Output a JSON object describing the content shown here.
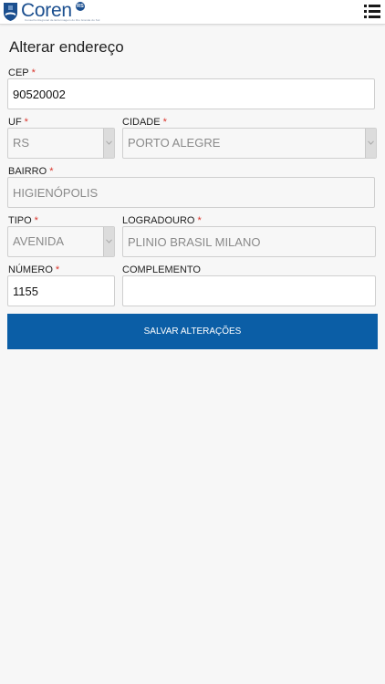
{
  "header": {
    "brand": "Coren",
    "badge": "RS",
    "tagline": "Conselho Regional de Enfermagem do Rio Grande do Sul",
    "logo_icon": "shield-icon",
    "menu_icon": "list-menu-icon",
    "brand_color": "#1b4f8f"
  },
  "page": {
    "title": "Alterar endereço"
  },
  "form": {
    "required_mark": "*",
    "cep": {
      "label": "CEP",
      "value": "90520002"
    },
    "uf": {
      "label": "UF",
      "value": "RS"
    },
    "cidade": {
      "label": "CIDADE",
      "value": "PORTO ALEGRE"
    },
    "bairro": {
      "label": "BAIRRO",
      "value": "HIGIENÓPOLIS"
    },
    "tipo": {
      "label": "TIPO",
      "value": "AVENIDA"
    },
    "logradouro": {
      "label": "LOGRADOURO",
      "value": "PLINIO BRASIL MILANO"
    },
    "numero": {
      "label": "NÚMERO",
      "value": "1155"
    },
    "complemento": {
      "label": "COMPLEMENTO",
      "value": ""
    },
    "submit_label": "SALVAR ALTERAÇÕES"
  },
  "colors": {
    "accent": "#0b5ea6",
    "required": "#d9342b",
    "background": "#f7f7f7"
  }
}
